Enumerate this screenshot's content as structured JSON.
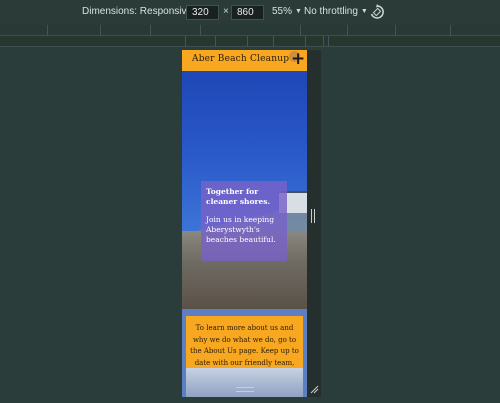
{
  "devtools": {
    "dimensions_label": "Dimensions: Responsive",
    "width_value": "320",
    "times": "×",
    "height_value": "860",
    "zoom_label": "55%",
    "throttle_label": "No throttling",
    "rotate_icon": "rotate-icon",
    "caret_icon": "caret-down-icon"
  },
  "site": {
    "title": "Aber Beach Cleanup",
    "menu_icon": "plus-icon",
    "hero": {
      "line1": "Together for cleaner shores.",
      "line2": "Join us in keeping Aberystwyth's beaches beautiful."
    },
    "info_text": "To learn more about us and why we do what we do, go to the About Us page. Keep up to date with our friendly team, or make a donation, on our Support Us page."
  },
  "colors": {
    "accent": "#f7a720",
    "hero_box": "#7862c8",
    "info_bg": "#5b7fc2",
    "background": "#2b3d3a"
  }
}
